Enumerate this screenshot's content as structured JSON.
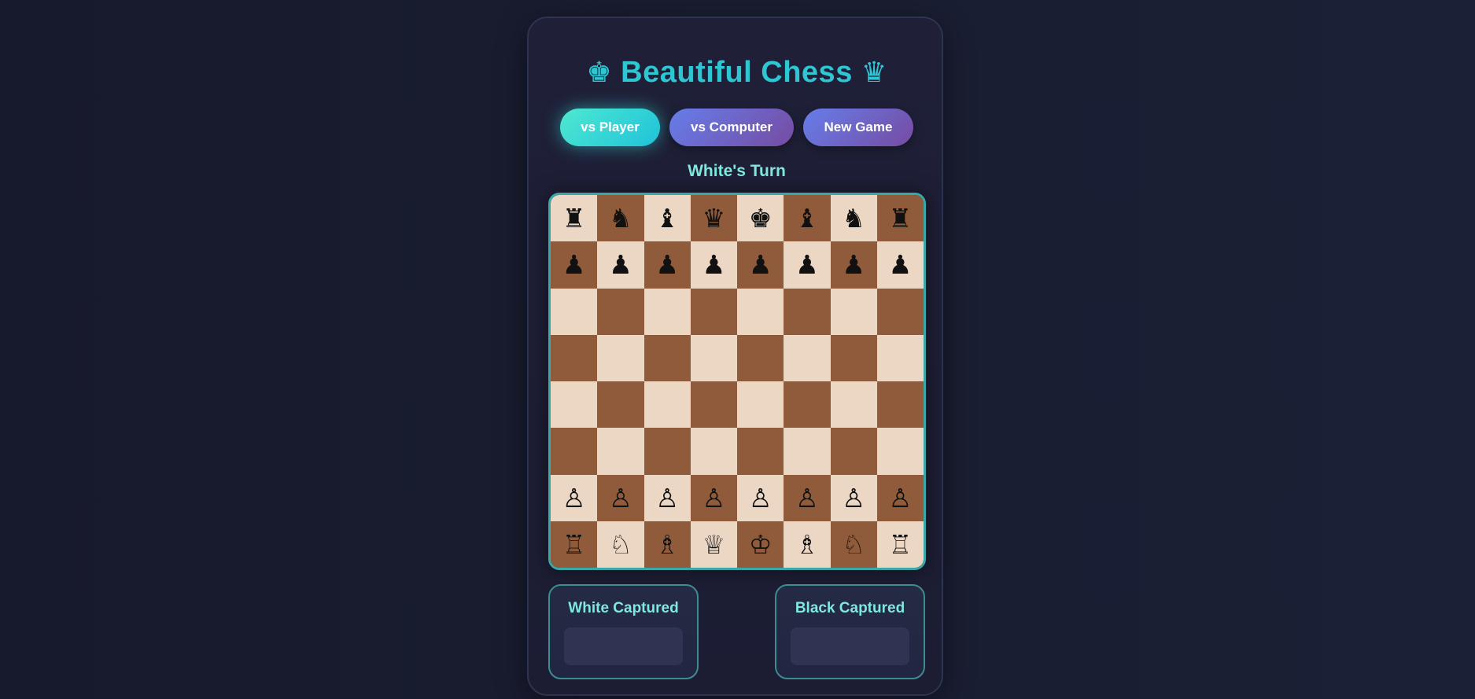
{
  "app": {
    "title_icon_left": "♚",
    "title_text": "Beautiful Chess",
    "title_icon_right": "♛"
  },
  "controls": {
    "buttons": [
      {
        "label": "vs Player",
        "active": true
      },
      {
        "label": "vs Computer",
        "active": false
      },
      {
        "label": "New Game",
        "active": false
      }
    ]
  },
  "status": {
    "turn": "White's Turn"
  },
  "board": {
    "rows": [
      [
        "♜",
        "♞",
        "♝",
        "♛",
        "♚",
        "♝",
        "♞",
        "♜"
      ],
      [
        "♟",
        "♟",
        "♟",
        "♟",
        "♟",
        "♟",
        "♟",
        "♟"
      ],
      [
        "",
        "",
        "",
        "",
        "",
        "",
        "",
        ""
      ],
      [
        "",
        "",
        "",
        "",
        "",
        "",
        "",
        ""
      ],
      [
        "",
        "",
        "",
        "",
        "",
        "",
        "",
        ""
      ],
      [
        "",
        "",
        "",
        "",
        "",
        "",
        "",
        ""
      ],
      [
        "♙",
        "♙",
        "♙",
        "♙",
        "♙",
        "♙",
        "♙",
        "♙"
      ],
      [
        "♖",
        "♘",
        "♗",
        "♕",
        "♔",
        "♗",
        "♘",
        "♖"
      ]
    ],
    "light_color": "#ecd7c4",
    "dark_color": "#8f5b3a"
  },
  "captured": {
    "white_label": "White Captured",
    "white_pieces": [],
    "black_label": "Black Captured",
    "black_pieces": []
  },
  "colors": {
    "accent": "#2ec6d3",
    "button_gradient_start": "#667eea",
    "button_gradient_end": "#764ba2",
    "active_button": "#4fe8d1"
  }
}
